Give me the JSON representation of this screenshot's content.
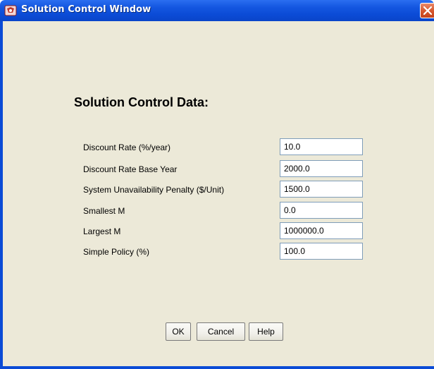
{
  "window": {
    "title": "Solution Control Window",
    "app_icon": "app-icon",
    "close_icon": "close-icon"
  },
  "form": {
    "heading": "Solution Control Data:",
    "rows": [
      {
        "label": "Discount Rate (%/year)",
        "value": "10.0"
      },
      {
        "label": "Discount Rate Base Year",
        "value": "2000.0"
      },
      {
        "label": "System Unavailability Penalty ($/Unit)",
        "value": "1500.0"
      },
      {
        "label": "Smallest M",
        "value": "0.0"
      },
      {
        "label": "Largest M",
        "value": "1000000.0"
      },
      {
        "label": "Simple Policy (%)",
        "value": "100.0"
      }
    ]
  },
  "buttons": {
    "ok": "OK",
    "cancel": "Cancel",
    "help": "Help"
  },
  "colors": {
    "titlebar": "#0b4bd6",
    "panel": "#ece9d8",
    "close": "#d6552a"
  }
}
